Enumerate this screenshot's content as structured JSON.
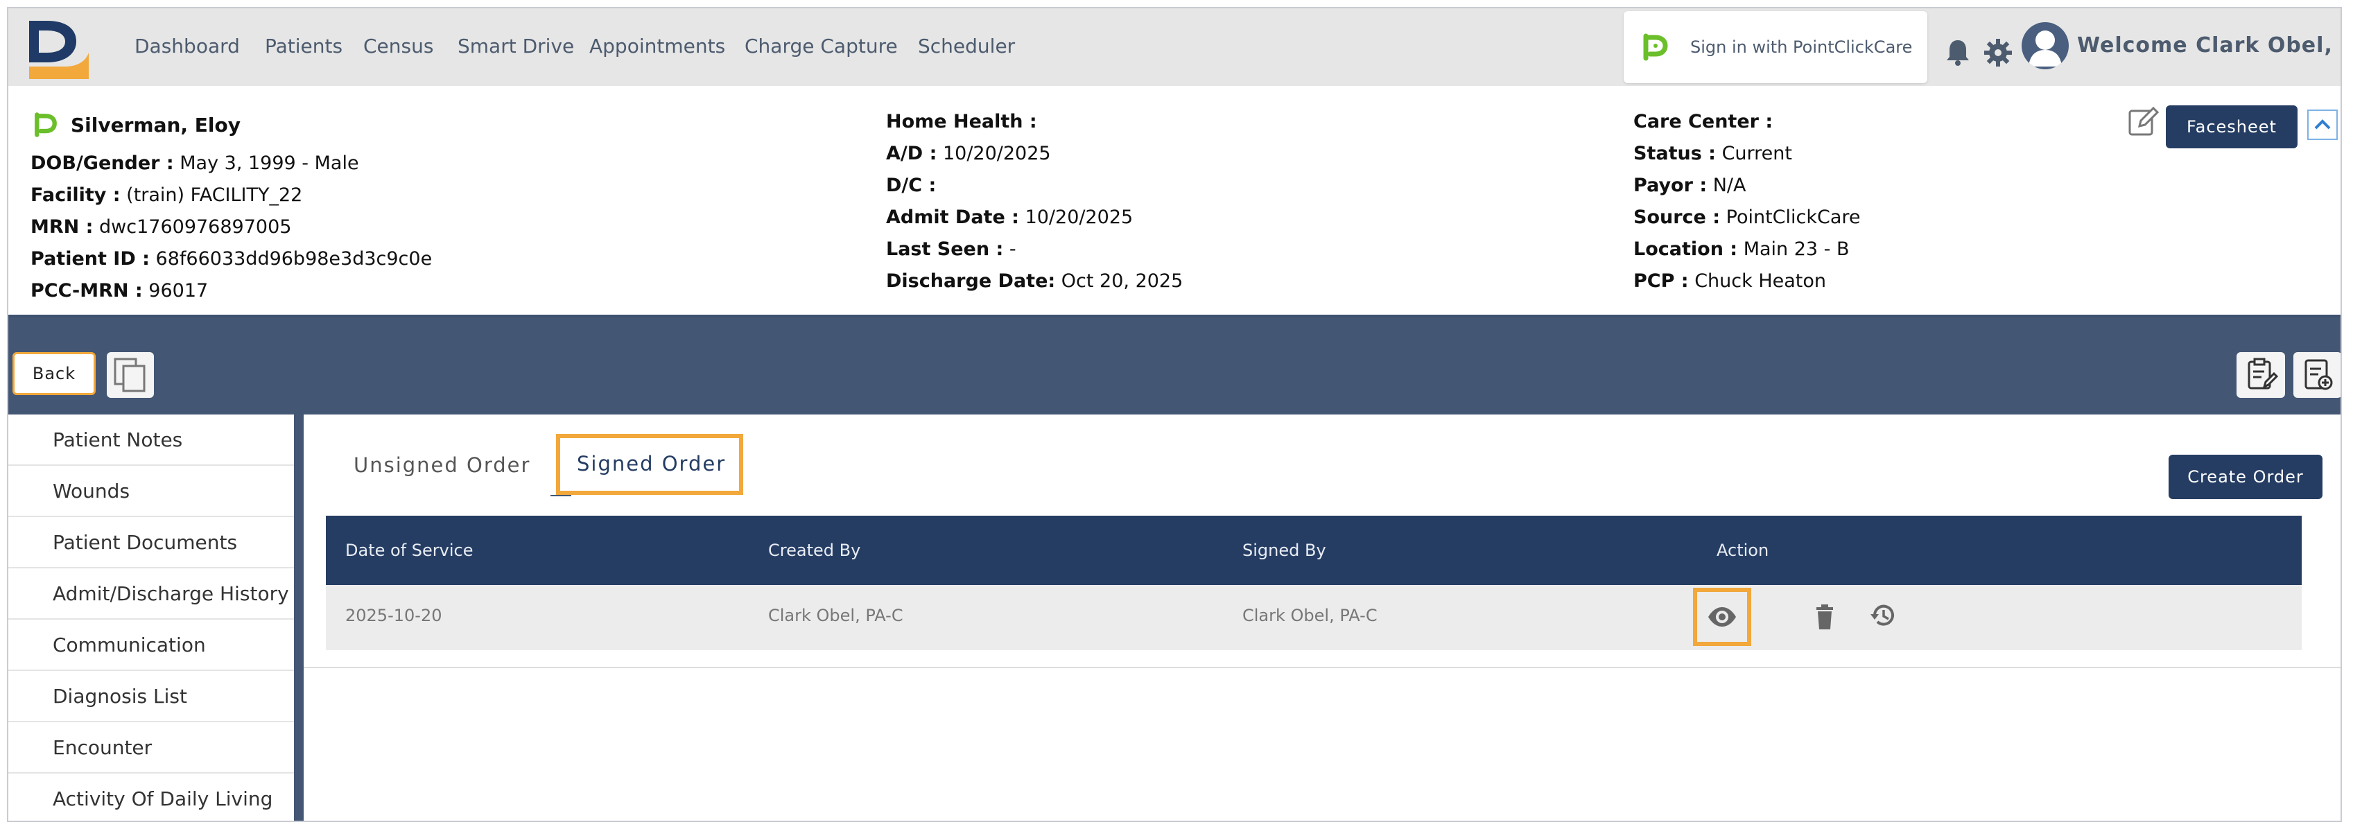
{
  "nav": {
    "items": [
      "Dashboard",
      "Patients",
      "Census",
      "Smart Drive",
      "Appointments",
      "Charge Capture",
      "Scheduler"
    ],
    "pcc_signin": "Sign in with PointClickCare",
    "welcome": "Welcome Clark Obel, PA-C",
    "icons": [
      "bell-icon",
      "gear-icon",
      "avatar-icon"
    ]
  },
  "patient": {
    "name": "Silverman, Eloy",
    "col1": [
      {
        "label": "DOB/Gender :",
        "value": "May 3, 1999 - Male"
      },
      {
        "label": "Facility :",
        "value": "(train) FACILITY_22"
      },
      {
        "label": "MRN :",
        "value": "dwc1760976897005"
      },
      {
        "label": "Patient ID :",
        "value": "68f66033dd96b98e3d3c9c0e"
      },
      {
        "label": "PCC-MRN :",
        "value": "96017"
      }
    ],
    "col2": [
      {
        "label": "Home Health :",
        "value": ""
      },
      {
        "label": "A/D :",
        "value": "10/20/2025"
      },
      {
        "label": "D/C :",
        "value": ""
      },
      {
        "label": "Admit Date :",
        "value": "10/20/2025"
      },
      {
        "label": "Last Seen :",
        "value": "-"
      },
      {
        "label": "Discharge Date:",
        "value": "Oct 20, 2025"
      }
    ],
    "col3": [
      {
        "label": "Care Center :",
        "value": ""
      },
      {
        "label": "Status :",
        "value": "Current"
      },
      {
        "label": "Payor :",
        "value": "N/A"
      },
      {
        "label": "Source :",
        "value": "PointClickCare"
      },
      {
        "label": "Location :",
        "value": "Main 23 - B"
      },
      {
        "label": "PCP :",
        "value": "Chuck Heaton"
      }
    ],
    "facesheet": "Facesheet"
  },
  "toolbar": {
    "back": "Back"
  },
  "sidebar": {
    "items": [
      "Patient Notes",
      "Wounds",
      "Patient Documents",
      "Admit/Discharge History",
      "Communication",
      "Diagnosis List",
      "Encounter",
      "Activity Of Daily Living"
    ]
  },
  "main": {
    "tabs": [
      "Unsigned Order",
      "Signed Order"
    ],
    "active_tab": "Signed Order",
    "create_order": "Create Order",
    "table": {
      "headers": [
        "Date of Service",
        "Created By",
        "Signed By",
        "Action"
      ],
      "rows": [
        {
          "date": "2025-10-20",
          "created_by": "Clark Obel, PA-C",
          "signed_by": "Clark Obel, PA-C"
        }
      ]
    }
  },
  "colors": {
    "navy": "#253d63",
    "band": "#435674",
    "highlight": "#f2a83b",
    "pcc_green": "#6bbf2a",
    "logo_orange": "#f2a83b"
  }
}
